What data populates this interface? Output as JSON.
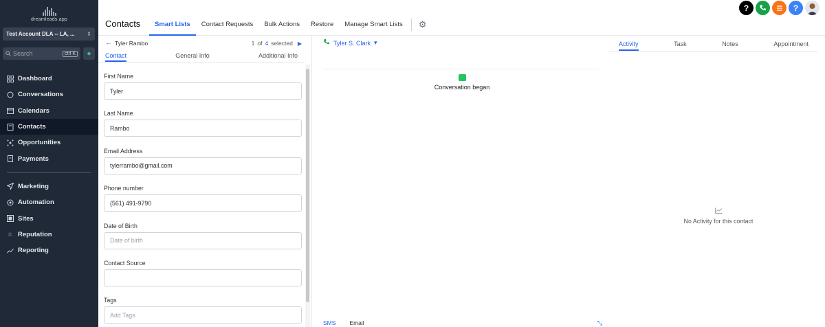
{
  "sidebar": {
    "logo_text": "dreamleads.app",
    "account_name": "Test Account DLA -- LA, ...",
    "search_placeholder": "Search",
    "search_shortcut": "ctrl K",
    "nav_primary": [
      {
        "label": "Dashboard",
        "icon": "grid-icon"
      },
      {
        "label": "Conversations",
        "icon": "chat-icon"
      },
      {
        "label": "Calendars",
        "icon": "calendar-icon"
      },
      {
        "label": "Contacts",
        "icon": "contacts-icon",
        "active": true
      },
      {
        "label": "Opportunities",
        "icon": "opportunities-icon"
      },
      {
        "label": "Payments",
        "icon": "payments-icon"
      }
    ],
    "nav_secondary": [
      {
        "label": "Marketing",
        "icon": "send-icon"
      },
      {
        "label": "Automation",
        "icon": "automation-icon"
      },
      {
        "label": "Sites",
        "icon": "sites-icon"
      },
      {
        "label": "Reputation",
        "icon": "star-icon"
      },
      {
        "label": "Reporting",
        "icon": "trend-icon"
      }
    ]
  },
  "header": {
    "title": "Contacts",
    "tabs": [
      "Smart Lists",
      "Contact Requests",
      "Bulk Actions",
      "Restore",
      "Manage Smart Lists"
    ],
    "active_tab": "Smart Lists",
    "icon_colors": [
      "#000000",
      "#16a34a",
      "#f97316",
      "#3b82f6"
    ]
  },
  "contact_panel": {
    "back_label": "Tyler Rambo",
    "pager": {
      "current": "1",
      "of": "of",
      "total": "4",
      "suffix": "selected"
    },
    "subtabs": [
      "Contact",
      "General Info",
      "Additional Info"
    ],
    "fields": [
      {
        "label": "First Name",
        "value": "Tyler",
        "placeholder": ""
      },
      {
        "label": "Last Name",
        "value": "Rambo",
        "placeholder": ""
      },
      {
        "label": "Email Address",
        "value": "tylerrambo@gmail.com",
        "placeholder": ""
      },
      {
        "label": "Phone number",
        "value": "(561) 491-9790",
        "placeholder": ""
      },
      {
        "label": "Date of Birth",
        "value": "",
        "placeholder": "Date of birth"
      },
      {
        "label": "Contact Source",
        "value": "",
        "placeholder": ""
      },
      {
        "label": "Tags",
        "value": "",
        "placeholder": "Add Tags"
      }
    ]
  },
  "conversation": {
    "assignee": "Tyler S. Clark",
    "event": "Conversation began",
    "footer_tabs": [
      "SMS",
      "Email"
    ]
  },
  "activity_panel": {
    "tabs": [
      "Activity",
      "Task",
      "Notes",
      "Appointment"
    ],
    "active_tab": "Activity",
    "empty_text": "No Activity for this contact"
  }
}
